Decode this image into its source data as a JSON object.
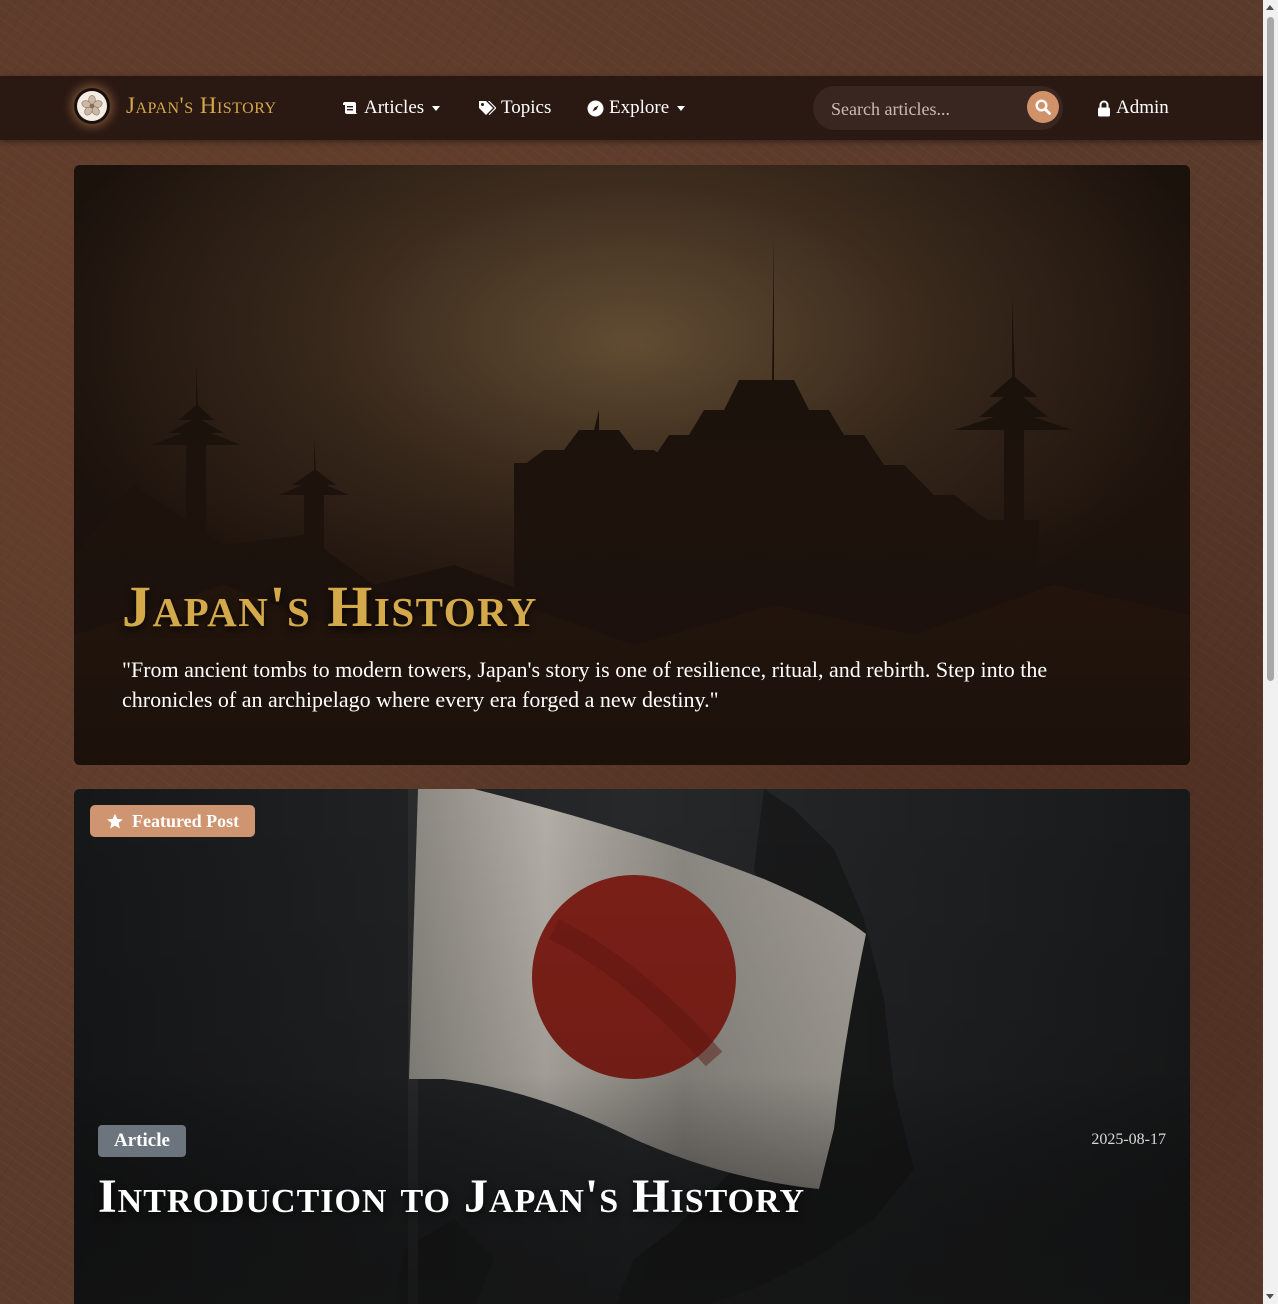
{
  "navbar": {
    "brand_title": "Japan's History",
    "links": [
      {
        "label": "Articles",
        "icon": "scroll-icon",
        "dropdown": true
      },
      {
        "label": "Topics",
        "icon": "tags-icon",
        "dropdown": false
      },
      {
        "label": "Explore",
        "icon": "compass-icon",
        "dropdown": true
      }
    ],
    "search": {
      "placeholder": "Search articles..."
    },
    "admin_label": "Admin"
  },
  "hero": {
    "title": "Japan's History",
    "quote": "\"From ancient tombs to modern towers, Japan's story is one of resilience, ritual, and rebirth. Step into the chronicles of an archipelago where every era forged a new destiny.\""
  },
  "featured": {
    "badge": "Featured Post",
    "category": "Article",
    "date": "2025-08-17",
    "title": "Introduction to Japan's History"
  },
  "colors": {
    "accent_gold": "#d4a94a",
    "accent_copper": "#d1926a",
    "navbar_bg": "#2a1812",
    "badge_gray": "#6c757d"
  }
}
